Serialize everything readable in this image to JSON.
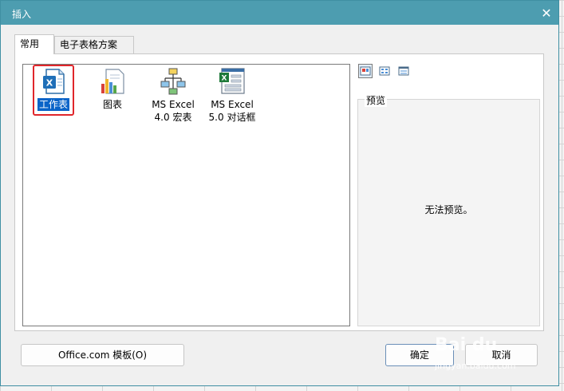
{
  "window": {
    "title": "插入",
    "close_glyph": "✕"
  },
  "tabs": [
    {
      "label": "常用",
      "active": true
    },
    {
      "label": "电子表格方案",
      "active": false
    }
  ],
  "items": [
    {
      "label": "工作表",
      "icon": "excel-worksheet-icon",
      "selected": true
    },
    {
      "label": "图表",
      "icon": "chart-icon",
      "selected": false
    },
    {
      "label": "MS Excel\n4.0 宏表",
      "icon": "macro-sheet-icon",
      "selected": false
    },
    {
      "label": "MS Excel\n5.0 对话框",
      "icon": "dialog-sheet-icon",
      "selected": false
    }
  ],
  "view_buttons": [
    "large-icons-view",
    "list-view",
    "details-view"
  ],
  "preview": {
    "legend": "预览",
    "message": "无法预览。"
  },
  "buttons": {
    "office_templates": "Office.com 模板(O)",
    "ok": "确定",
    "cancel": "取消"
  },
  "watermark": {
    "brand": "Bai du",
    "url": "jingyan.baidu.com"
  },
  "colors": {
    "titlebar": "#4d9db0",
    "selection": "#0a64c8",
    "highlight_box": "#e0262b"
  }
}
